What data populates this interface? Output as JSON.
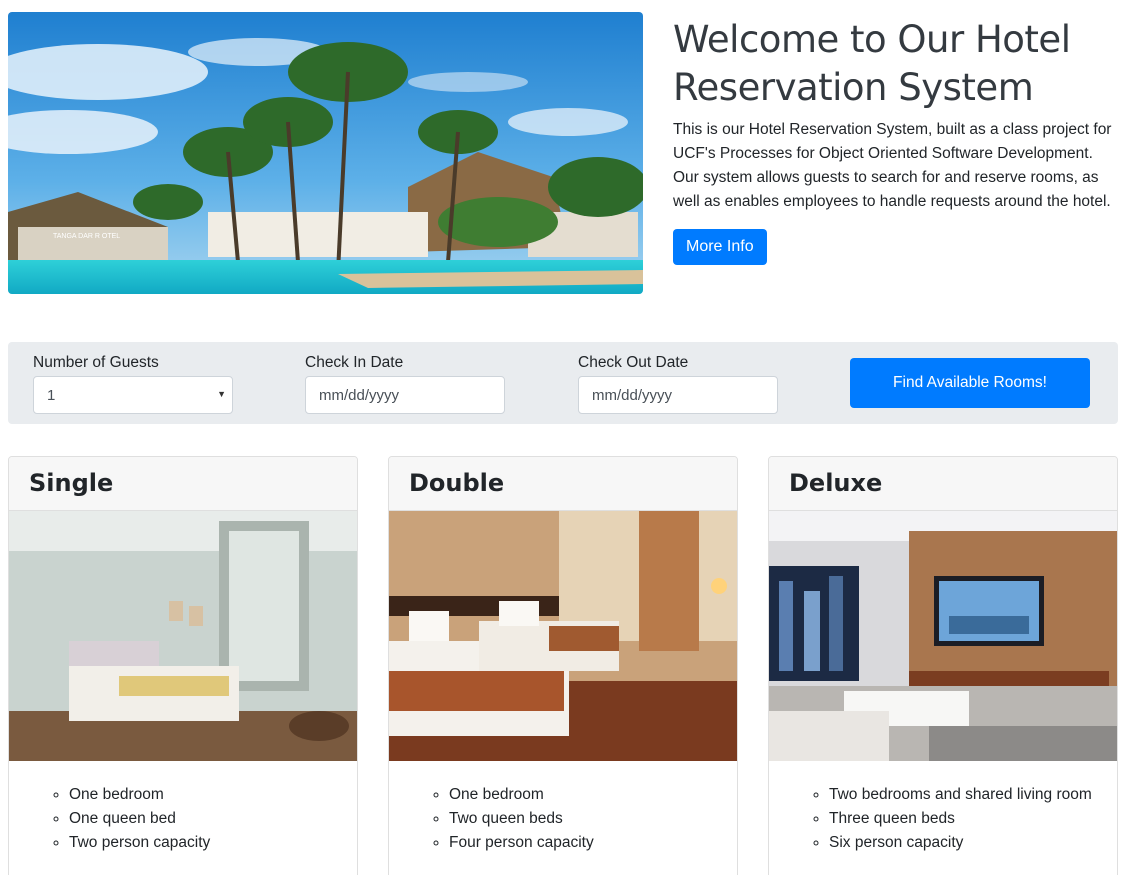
{
  "hero": {
    "title": "Welcome to Our Hotel Reservation System",
    "description": "This is our Hotel Reservation System, built as a class project for UCF's Processes for Object Oriented Software Development. Our system allows guests to search for and reserve rooms, as well as enables employees to handle requests around the hotel.",
    "more_info_label": "More Info",
    "image_sign_text": "TANGA DAR R OTEL"
  },
  "search": {
    "guests_label": "Number of Guests",
    "guests_value": "1",
    "checkin_label": "Check In Date",
    "checkin_placeholder": "mm/dd/yyyy",
    "checkout_label": "Check Out Date",
    "checkout_placeholder": "mm/dd/yyyy",
    "find_label": "Find Available Rooms!"
  },
  "rooms": [
    {
      "title": "Single",
      "features": [
        "One bedroom",
        "One queen bed",
        "Two person capacity"
      ]
    },
    {
      "title": "Double",
      "features": [
        "One bedroom",
        "Two queen beds",
        "Four person capacity"
      ]
    },
    {
      "title": "Deluxe",
      "features": [
        "Two bedrooms and shared living room",
        "Three queen beds",
        "Six person capacity"
      ]
    }
  ],
  "colors": {
    "primary": "#007bff",
    "search_bg": "#e9ecef",
    "card_header_bg": "#f7f7f7"
  }
}
